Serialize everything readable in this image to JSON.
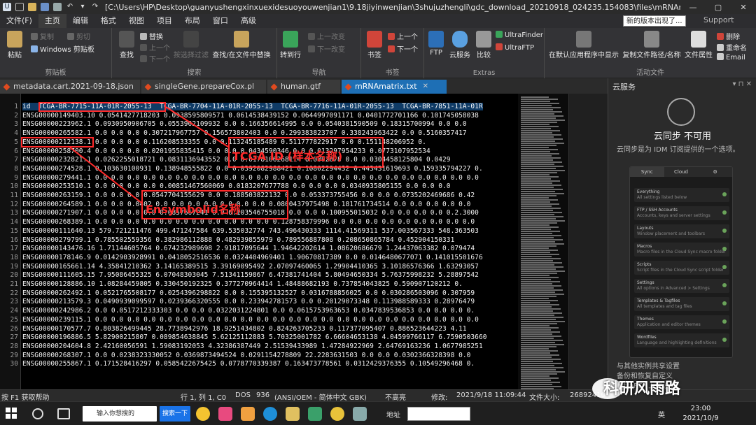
{
  "window": {
    "title": "[C:\\Users\\HP\\Desktop\\guanyushengxinxuexidesuoyouwenjian1\\9.18jiyinwenjian\\3shujuzhengli\\gdc_download_20210918_024235.154083\\files\\mRNAmatrix..."
  },
  "menu": {
    "items": [
      "文件(F)",
      "主页",
      "编辑",
      "格式",
      "视图",
      "项目",
      "布局",
      "窗口",
      "高级"
    ],
    "notify": "新的版本出现了...",
    "support": "Support"
  },
  "ribbon": {
    "paste": "粘贴",
    "copy": "复制",
    "cut": "剪切",
    "clipboard_mode": "Windows 剪贴板",
    "clipboard_group": "剪贴板",
    "find": "查找",
    "replace": "替换",
    "up": "上一个",
    "down": "下一个",
    "filter": "按选择过滤",
    "find_in_files": "查找/在文件中替换",
    "search_group": "搜索",
    "goto": "转到行",
    "prev_change": "上一改变",
    "next_change": "下一改变",
    "nav_group": "导航",
    "bookmark": "书签",
    "bm_prev": "上一个",
    "bm_next": "下一个",
    "bookmark_group": "书签",
    "ftp": "FTP",
    "cloud": "云服务",
    "compare": "比较",
    "ultrafinder": "UltraFinder",
    "ultraftp": "UltraFTP",
    "extras_group": "Extras",
    "show_in_app": "在默认应用程序中显示",
    "copy_path": "复制文件路径/名称",
    "file_props": "文件属性",
    "delete": "删除",
    "rename": "重命名",
    "email": "Email",
    "active_group": "活动文件"
  },
  "tabs": [
    {
      "label": "metadata.cart.2021-09-18.json",
      "active": false
    },
    {
      "label": "singleGene.prepareCox.pl",
      "active": false
    },
    {
      "label": "human.gtf",
      "active": false
    },
    {
      "label": "mRNAmatrix.txt",
      "active": true
    }
  ],
  "editor": {
    "lines": [
      "id  TCGA-BR-7715-11A-01R-2055-13  TCGA-BR-7704-11A-01R-2055-13  TCGA-BR-7716-11A-01R-2055-13  TCGA-BR-7851-11A-01R",
      "ENSG00000149403.10 0.0541427718203 0.0938595809571 0.0614538439152 0.0644997091171 0.0401772701166 0.101745058038",
      "ENSG00000223962.1 0.0930950906705 0.0553902109932 0.0 0.166356614995 0.0 0.0540381590509 0.18315700994 0.0 0.0",
      "ENSG00000265582.1 0.0 0.0 0.0 0.307217967757 0.156573802403 0.0 0.299383823707 0.338243963422 0.0 0.5160357417",
      "ENSG00000212138.1 0.0 0.0 0.0 0.116208533355 0.0 0.113245185489 0.511777822917 0.0 0.151148206952 0.",
      "ENSG00000258700.4 0.0 0.0 0.0 0.0201955835415 0.0 0.0 0.0434590346 0.0 0.013297954233 0.0773107952534",
      "ENSG00000232821.1 0.0262255018721 0.0831136943552 0.0 0.0178106268114 0.0392078 0.0 0.0304458125804 0.0429",
      "ENSG00000274528.1 0.103630100931 0.138948555822 0.0 0.0392082988421 0.10802294432 0.443431619693 0.159335794227 0.",
      "ENSG00000279441.1 0.0 0.0 0.0 0.0 0.0 0.0 0.0 0.0 0.0 0.0 0.0 0.0 0.0 0.0 0.0 0.0 0.0 0.0 0.0 0.0 0.0 0.0 0.0 0.0",
      "ENSG00000253510.1 0.0 0.0 0.0 0.0 0.00851467560069 0.0183207677788 0.0 0.0 0.0 0.0340935805155 0.0 0.0 0.0",
      "ENSG00000263159.1 0.0 0.0 0.0 0.0547704155629 0.0 0.188503822132 0.0 0.053373755456 0.0 0.0 0.0735202469686 0.42",
      "ENSG00000264589.1 0.0 0.0 0.0402 0.0 0.0 0.0 0.0 0.0 0.0 0.0 0.0800437975498 0.181761734514 0.0 0.0 0.0 0.0 0.0",
      "ENSG00000271907.1 0.0 0.0 0.0 0.0 0.0857667241 0.0 0.103546755018 0.0 0.0 0.100955015032 0.0 0.0 0.0 0.0 0.2.3000",
      "ENSG00000268389.1 0.0 0.0 0.0 0.0 0.0 0.0 0.0 0.0 0.0 0.0 0.0 0.128758379996 0.0 0.0 0.0 0.0 0.0 0.0 0.0 0.0 0.0",
      "ENSG00000111640.13 579.721211476 499.471247584 639.535032774 743.496430333 1114.41569311 537.003567333 548.363503",
      "ENSG00000279799.1 0.785502559356 0.382986112888 0.482939855979 0.789556887808 0.208650865784 0.452904150331",
      "ENSG00000143476.16 1.71144605764 0.674232989698 2.91817095644 1.94642202614 1.08620686679 1.24437063382 0.079474",
      "ENSG00000178146.9 0.0142903928991 0.0418052516536 0.0324404969401 1.90670817389 0.0 0.0146480677071 0.141015501676",
      "ENSG00000165661.14 4.35841210362 3.14165389515 3.39169095492 2.07097460065 1.29904410365 3.10186576366 1.63293057",
      "ENSG00000111605.15 7.95086455325 6.07048303045 7.51341159867 6.47381741404 5.80494650334 5.76375998232 5.28897542",
      "ENSG00000128886.10 1.08284459805 0.330450192325 0.377270964414 1.48488682193 0.737854043825 0.590907120212 0.",
      "ENSG00000262492.1 0.0521765508177 0.0254396298822 0.0 0.155395132527 0.0316788856025 0.0 0.030286503096 0.307959",
      "ENSG00000213579.3 0.0490939099597 0.0239366320555 0.0 0.233942781573 0.0 0.20129073348 0.113988589333 0.28976479",
      "ENSG00000242986.2 0.0 0.0517212333303 0.0 0.0 0.0322031224801 0.0 0.0615753963653 0.0347839536853 0.0 0.0 0.0 0.",
      "ENSG00000239115.1 0.0 0.0 0.0 0.0 0.0 0.0 0.0 0.0 0.0 0.0 0.0 0.0 0.0 0.0 0.0 0.0 0.0 0.0 0.0 0.0 0.0 0.0 0.0 0.0",
      "ENSG00000170577.7 0.803826499445 28.7738942976 18.9251434802 0.824263705233 0.117377095407 0.886523644223 4.11",
      "ENSG00000196886.5 5.82900215807 0.089854638845 5.62125112883 5.70325001782 6.66604653138 4.04599766117 6.7590503660",
      "ENSG00000204604.8 2.42160056591 1.59083192053 4.32386387449 2.51539433989 1.47284922969 2.64769163236 1.0677985251",
      "ENSG00000268307.1 0.0 0.0238323330052 0.0369873494524 0.0291154278809 22.2283631503 0.0 0.0 0.0302366328398 0.0",
      "ENSG00000255867.1 0.171528416297 0.0585422675425 0.0778770339387 0.163473778561 0.0312429376355 0.10549296468 0."
    ]
  },
  "annotations": {
    "tcga_label": "TCGA ID (样本名称)",
    "ens_label": "Ensymbolid名称"
  },
  "cloud": {
    "panel_title": "云服务",
    "heading": "云同步 不可用",
    "desc": "云同步是为 IDM 订阅提供的一个选项。",
    "shot_tabs": [
      "Sync",
      "Cloud",
      "⚙"
    ],
    "shot_items": [
      {
        "t": "Everything",
        "s": "All settings listed below"
      },
      {
        "t": "FTP / SSH Accounts",
        "s": "Accounts, keys and server settings"
      },
      {
        "t": "Layouts",
        "s": "Window placement and toolbars"
      },
      {
        "t": "Macros",
        "s": "Macro files in the Cloud Sync macro folder"
      },
      {
        "t": "Scripts",
        "s": "Script files in the Cloud Sync script folder"
      },
      {
        "t": "Settings",
        "s": "All options in Advanced > Settings"
      },
      {
        "t": "Templates & Tagfiles",
        "s": "All templates and tag files"
      },
      {
        "t": "Themes",
        "s": "Application and editor themes"
      },
      {
        "t": "Wordfiles",
        "s": "Language and highlighting definitions"
      }
    ],
    "links": [
      "与其他实例共享设置",
      "备份和恢复自定义",
      "UltraFTP 上载设置"
    ]
  },
  "status": {
    "help": "按 F1 获取帮助",
    "pos": "行 1, 列 1, C0",
    "mode": "DOS",
    "codepage": "936",
    "encoding": "(ANSI/OEM - 简体中文 GBK)",
    "highlight": "不高亮",
    "modified": "修改:",
    "modified_time": "2021/9/18 11:09:44",
    "filesize_label": "文件大小:",
    "filesize": "26892410"
  },
  "taskbar": {
    "search_placeholder": "输入你想搜的",
    "search_btn": "搜索一下",
    "addr_label": "地址",
    "time": "23:00",
    "date": "2021/10/9",
    "ime": "英"
  },
  "watermark": "科研风雨路"
}
